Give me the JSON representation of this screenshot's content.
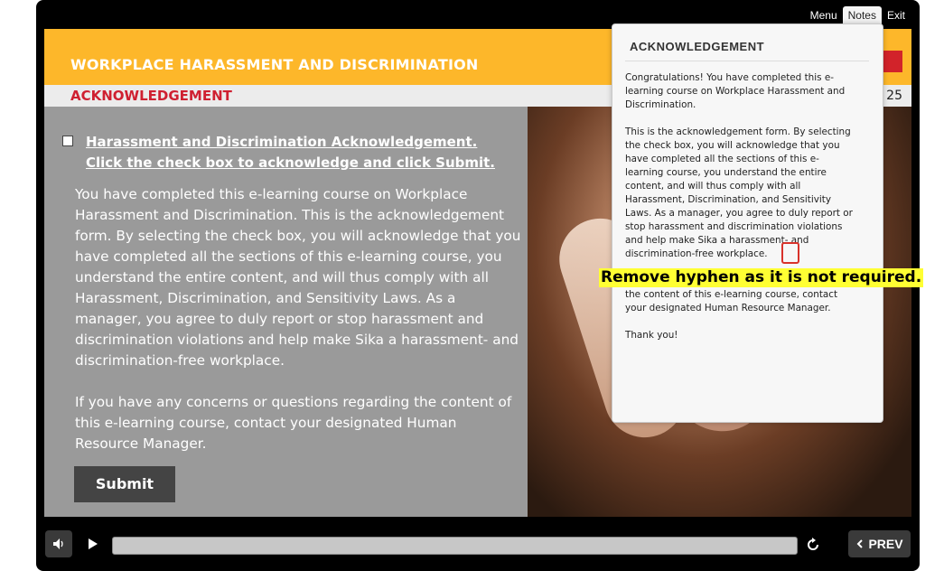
{
  "topbar": {
    "tabs": [
      "Menu",
      "Notes",
      "Exit"
    ],
    "active_tab": "Notes"
  },
  "slide": {
    "course_title": "WORKPLACE HARASSMENT AND DISCRIMINATION",
    "section_title": "ACKNOWLEDGEMENT",
    "page_count": "F 25",
    "acknowledgement_heading_line1": "Harassment and Discrimination Acknowledgement.",
    "acknowledgement_heading_line2": "Click the check box to acknowledge and click Submit.",
    "body_paragraph1": "You have completed this e-learning course on Workplace Harassment and Discrimination. This is the acknowledgement form. By selecting the check box, you will acknowledge that you have completed all the sections of this e-learning course, you understand the entire content, and will thus comply with all Harassment, Discrimination, and Sensitivity Laws. As a manager, you agree to duly report or stop harassment and discrimination violations and help make Sika a harassment- and discrimination-free workplace.",
    "body_paragraph2": "If you have any concerns or questions regarding the content of this e-learning course, contact your designated Human Resource Manager.",
    "submit_label": "Submit"
  },
  "notes": {
    "title": "ACKNOWLEDGEMENT",
    "paragraph1": "Congratulations! You have completed this e-learning course on Workplace Harassment and Discrimination.",
    "paragraph2": "This is the acknowledgement form. By selecting the check box, you will acknowledge that you have completed all the sections of this e-learning course, you understand the entire content, and will thus comply with all Harassment, Discrimination, and Sensitivity Laws. As a manager, you agree to duly report or stop harassment and discrimination violations and help make Sika a harassment- and discrimination-free workplace.",
    "paragraph3": "If you have any concerns or questions regarding the content of this e-learning course, contact your designated Human Resource Manager.",
    "paragraph4": "Thank you!"
  },
  "annotation": {
    "text": "Remove hyphen as it is not required."
  },
  "controls": {
    "prev_label": "PREV"
  },
  "colors": {
    "banner": "#fdb72a",
    "section_title": "#cf2031",
    "content_panel": "#9a9a9a",
    "annotation_bg": "#ffff33",
    "highlight_border": "#d8322a"
  }
}
